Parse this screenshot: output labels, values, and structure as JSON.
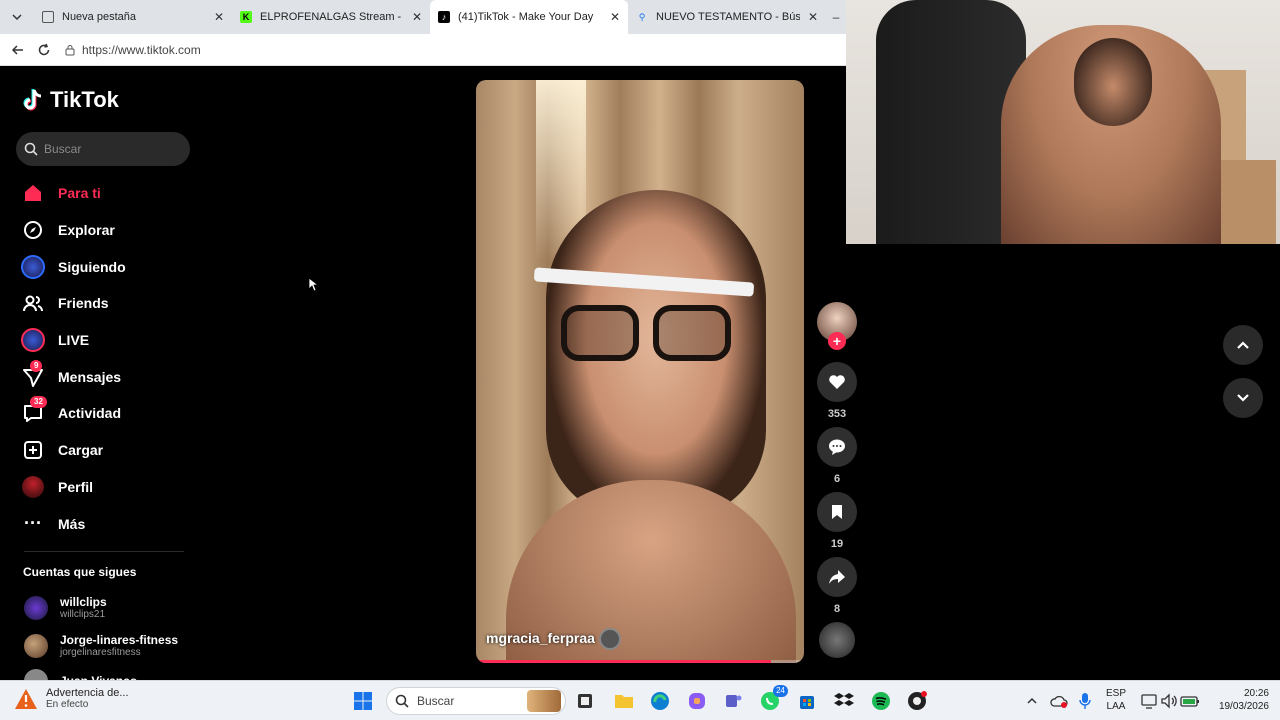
{
  "browser": {
    "tabs": [
      {
        "title": "Nueva pestaña",
        "active": false
      },
      {
        "title": "ELPROFENALGAS Stream - Watch",
        "active": false
      },
      {
        "title": "(41)TikTok - Make Your Day",
        "active": true
      },
      {
        "title": "NUEVO TESTAMENTO - Búsqueda",
        "active": false
      }
    ],
    "url": "https://www.tiktok.com"
  },
  "tiktok": {
    "logo": "TikTok",
    "search_placeholder": "Buscar",
    "nav": [
      {
        "label": "Para ti",
        "icon": "home-icon",
        "active": true
      },
      {
        "label": "Explorar",
        "icon": "compass-icon"
      },
      {
        "label": "Siguiendo",
        "icon": "following-avatar-icon"
      },
      {
        "label": "Friends",
        "icon": "friends-icon"
      },
      {
        "label": "LIVE",
        "icon": "live-avatar-icon"
      },
      {
        "label": "Mensajes",
        "icon": "messages-icon",
        "badge": "9"
      },
      {
        "label": "Actividad",
        "icon": "activity-icon",
        "badge": "32"
      },
      {
        "label": "Cargar",
        "icon": "upload-icon"
      },
      {
        "label": "Perfil",
        "icon": "profile-avatar-icon"
      },
      {
        "label": "Más",
        "icon": "more-icon"
      }
    ],
    "following_heading": "Cuentas que sigues",
    "following": [
      {
        "name": "willclips",
        "handle": "willclips21"
      },
      {
        "name": "Jorge-linares-fitness",
        "handle": "jorgelinaresfitness"
      },
      {
        "name": "Juan Vivanco",
        "handle": ""
      }
    ],
    "video": {
      "username": "mgracia_ferpraa",
      "progress": 0.9
    },
    "actions": {
      "likes": "353",
      "comments": "6",
      "saves": "19",
      "shares": "8"
    }
  },
  "taskbar": {
    "alert_title": "Advertencia de...",
    "alert_sub": "En efecto",
    "search_placeholder": "Buscar",
    "whatsapp_badge": "24",
    "lang": "ESP",
    "lang_sub": "LAA",
    "time": "20:26",
    "date": "19/03/2026"
  },
  "colors": {
    "accent": "#fe2c55",
    "bg": "#000000"
  }
}
